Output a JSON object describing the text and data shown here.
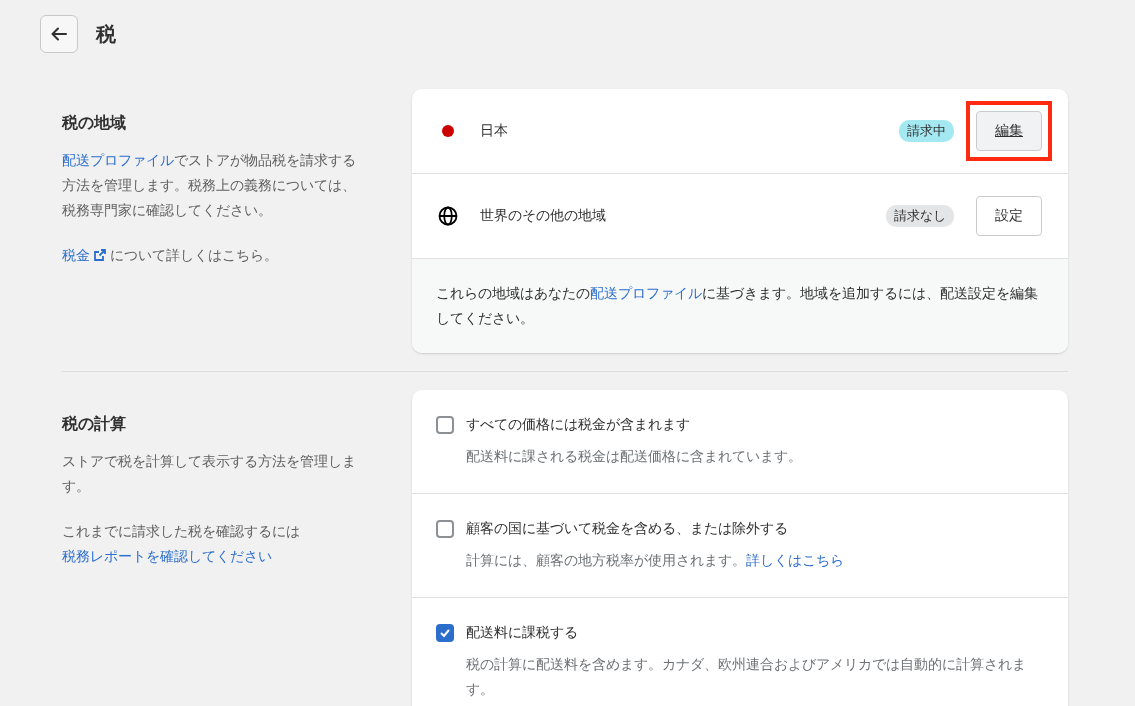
{
  "header": {
    "title": "税"
  },
  "sections": [
    {
      "title": "税の地域",
      "paragraphs": [
        [
          {
            "kind": "link",
            "text": "配送プロファイル"
          },
          {
            "kind": "text",
            "text": "でストアが物品税を請求する方法を管理します。税務上の義務については、税務専門家に確認してください。"
          }
        ],
        [
          {
            "kind": "external",
            "text": "税金"
          },
          {
            "kind": "text",
            "text": " について詳しくはこちら。"
          }
        ]
      ]
    },
    {
      "title": "税の計算",
      "paragraphs": [
        [
          {
            "kind": "text",
            "text": "ストアで税を計算して表示する方法を管理します。"
          }
        ],
        [
          {
            "kind": "text",
            "text": "これまでに請求した税を確認するには"
          },
          {
            "kind": "link",
            "text": "税務レポートを確認してください"
          }
        ]
      ]
    }
  ],
  "regions": [
    {
      "name": "日本",
      "kind": "dot",
      "color": "#cc0000",
      "badge": "請求中",
      "collecting": true,
      "button": "編集",
      "highlighted": true
    },
    {
      "name": "世界のその他の地域",
      "kind": "globe",
      "badge": "請求なし",
      "collecting": false,
      "button": "設定",
      "highlighted": false
    }
  ],
  "regions_note": [
    {
      "kind": "text",
      "text": "これらの地域はあなたの"
    },
    {
      "kind": "link",
      "text": "配送プロファイル"
    },
    {
      "kind": "text",
      "text": "に基づきます。地域を追加するには、配送設定を編集してください。"
    }
  ],
  "options": [
    {
      "label": "すべての価格には税金が含まれます",
      "checked": false,
      "description": [
        {
          "kind": "text",
          "text": "配送料に課される税金は配送価格に含まれています。"
        }
      ]
    },
    {
      "label": "顧客の国に基づいて税金を含める、または除外する",
      "checked": false,
      "description": [
        {
          "kind": "text",
          "text": "計算には、顧客の地方税率が使用されます。"
        },
        {
          "kind": "link",
          "text": "詳しくはこちら"
        }
      ]
    },
    {
      "label": "配送料に課税する",
      "checked": true,
      "description": [
        {
          "kind": "text",
          "text": "税の計算に配送料を含めます。カナダ、欧州連合およびアメリカでは自動的に計算されます。"
        }
      ]
    }
  ]
}
